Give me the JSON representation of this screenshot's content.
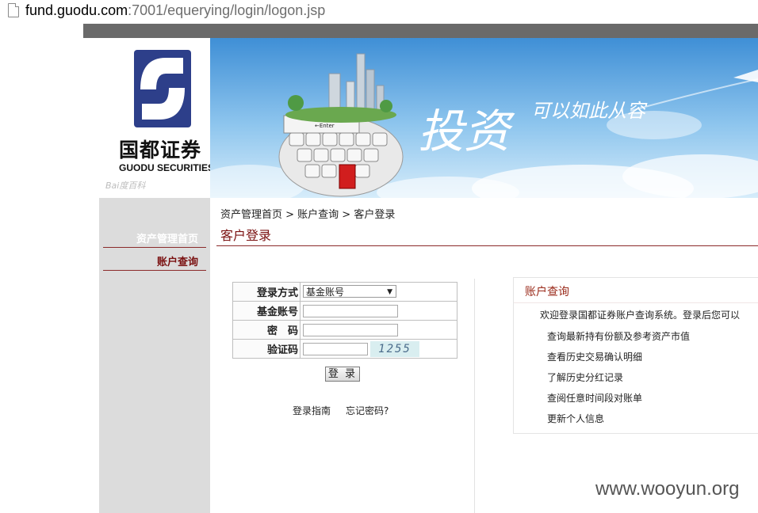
{
  "browser": {
    "url_host": "fund.guodu.com",
    "url_rest": ":7001/equerying/login/logon.jsp"
  },
  "logo": {
    "name_cn": "国都证券",
    "name_en": "GUODU SECURITIES",
    "watermark": "Bai度百科"
  },
  "banner": {
    "slogan_main": "投资",
    "slogan_sub": "可以如此从容",
    "key_label": "←Enter"
  },
  "sidebar": {
    "items": [
      {
        "label": "资产管理首页",
        "color": "#ffffff"
      },
      {
        "label": "账户查询",
        "color": "#7a1010"
      }
    ]
  },
  "breadcrumb": "资产管理首页 > 账户查询 > 客户登录",
  "page_title": "客户登录",
  "form": {
    "login_type_label": "登录方式",
    "login_type_value": "基金账号",
    "account_label": "基金账号",
    "password_label": "密　码",
    "captcha_label": "验证码",
    "captcha_text": "1255",
    "login_button": "登 录"
  },
  "links": {
    "guide": "登录指南",
    "forgot": "忘记密码?"
  },
  "info": {
    "title": "账户查询",
    "intro": "欢迎登录国都证券账户查询系统。登录后您可以",
    "items": [
      "查询最新持有份额及参考资产市值",
      "查看历史交易确认明细",
      "了解历史分红记录",
      "查阅任意时间段对账单",
      "更新个人信息"
    ]
  },
  "watermark_site": "www.wooyun.org"
}
